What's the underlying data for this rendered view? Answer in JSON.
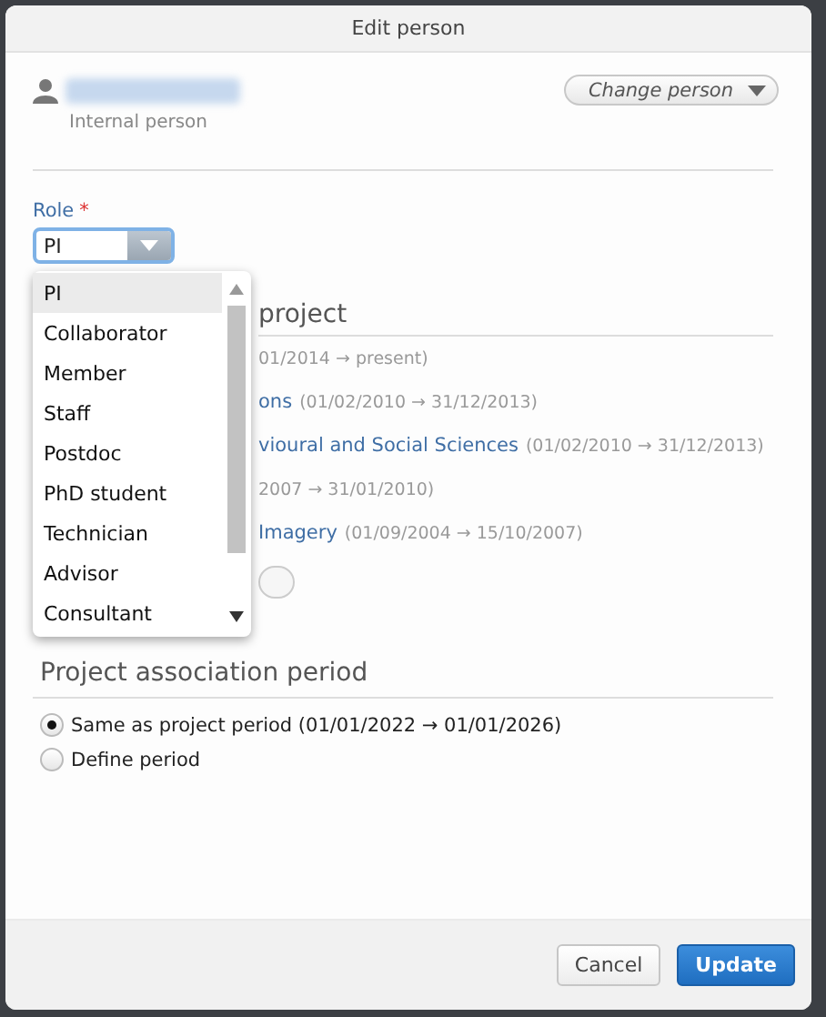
{
  "dialog": {
    "title": "Edit person"
  },
  "person": {
    "subtitle": "Internal person",
    "change_button": "Change person"
  },
  "role": {
    "label": "Role",
    "required_mark": "*",
    "value": "PI",
    "options": [
      {
        "label": "PI",
        "selected": true
      },
      {
        "label": "Collaborator",
        "selected": false
      },
      {
        "label": "Member",
        "selected": false
      },
      {
        "label": "Staff",
        "selected": false
      },
      {
        "label": "Postdoc",
        "selected": false
      },
      {
        "label": "PhD student",
        "selected": false
      },
      {
        "label": "Technician",
        "selected": false
      },
      {
        "label": "Advisor",
        "selected": false
      },
      {
        "label": "Consultant",
        "selected": false
      }
    ]
  },
  "projects": {
    "heading": "project",
    "items": [
      {
        "period": "01/2014 → present)"
      },
      {
        "name": "ons",
        "period": "(01/02/2010 → 31/12/2013)"
      },
      {
        "name": "vioural and Social Sciences",
        "period": "(01/02/2010 → 31/12/2013)"
      },
      {
        "period": "2007 → 31/01/2010)"
      },
      {
        "name": "Imagery",
        "period": "(01/09/2004 → 15/10/2007)"
      }
    ]
  },
  "association": {
    "heading": "Project association period",
    "options": [
      {
        "label": "Same as project period (01/01/2022 → 01/01/2026)",
        "selected": true
      },
      {
        "label": "Define period",
        "selected": false
      }
    ]
  },
  "buttons": [
    {
      "label": "Cancel",
      "kind": "secondary"
    },
    {
      "label": "Update",
      "kind": "primary"
    }
  ]
}
